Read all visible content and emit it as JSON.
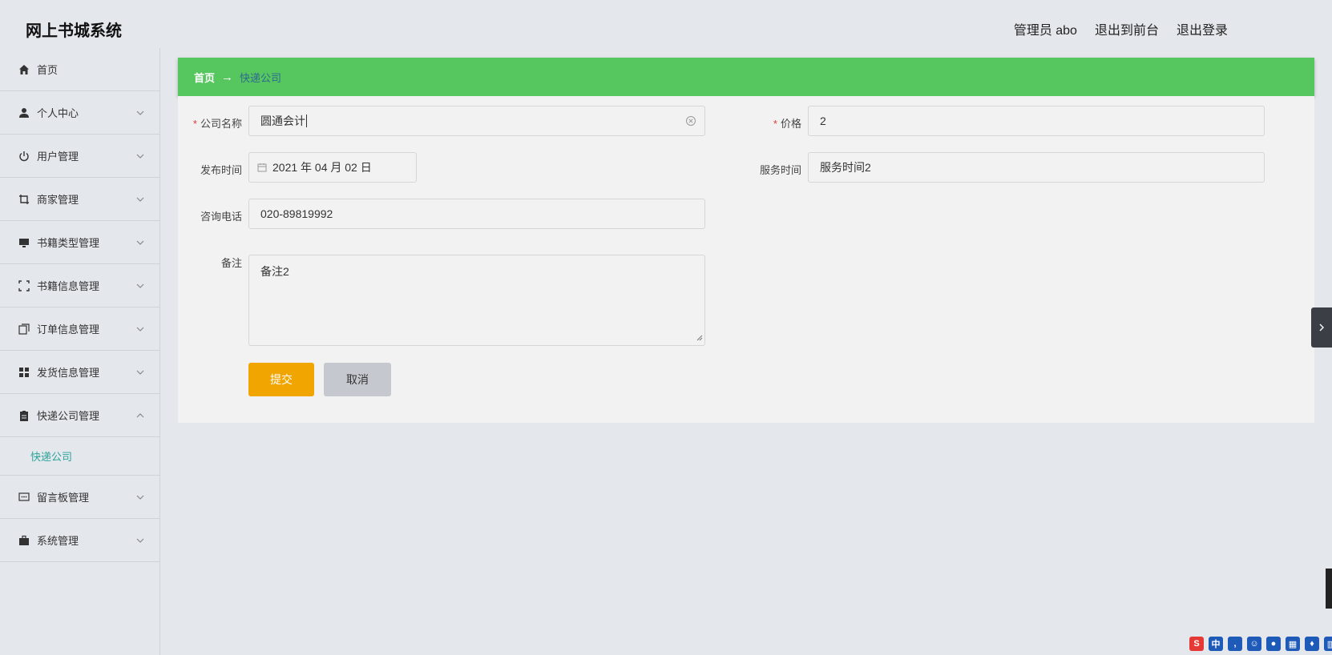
{
  "header": {
    "app_title": "网上书城系统",
    "user_label": "管理员 abo",
    "back_front": "退出到前台",
    "logout": "退出登录"
  },
  "sidebar": {
    "items": [
      {
        "label": "首页",
        "icon": "home-icon"
      },
      {
        "label": "个人中心",
        "icon": "user-icon"
      },
      {
        "label": "用户管理",
        "icon": "power-icon"
      },
      {
        "label": "商家管理",
        "icon": "crop-icon"
      },
      {
        "label": "书籍类型管理",
        "icon": "monitor-icon"
      },
      {
        "label": "书籍信息管理",
        "icon": "frame-icon"
      },
      {
        "label": "订单信息管理",
        "icon": "copy-icon"
      },
      {
        "label": "发货信息管理",
        "icon": "grid-icon"
      },
      {
        "label": "快递公司管理",
        "icon": "clipboard-icon"
      },
      {
        "label": "留言板管理",
        "icon": "message-icon"
      },
      {
        "label": "系统管理",
        "icon": "briefcase-icon"
      }
    ],
    "sub_item": "快递公司"
  },
  "breadcrumb": {
    "home": "首页",
    "arrow": "→",
    "current": "快递公司"
  },
  "form": {
    "company_name_label": "公司名称",
    "company_name_value": "圆通会计",
    "price_label": "价格",
    "price_value": "2",
    "publish_time_label": "发布时间",
    "publish_time_value": "2021 年 04 月 02 日",
    "service_time_label": "服务时间",
    "service_time_value": "服务时间2",
    "phone_label": "咨询电话",
    "phone_value": "020-89819992",
    "note_label": "备注",
    "note_value": "备注2",
    "submit_label": "提交",
    "cancel_label": "取消",
    "required_mark": "*"
  },
  "colors": {
    "breadcrumb_bg": "#56c65e",
    "submit_bg": "#f0a500",
    "active_sub": "#2ba39a"
  }
}
